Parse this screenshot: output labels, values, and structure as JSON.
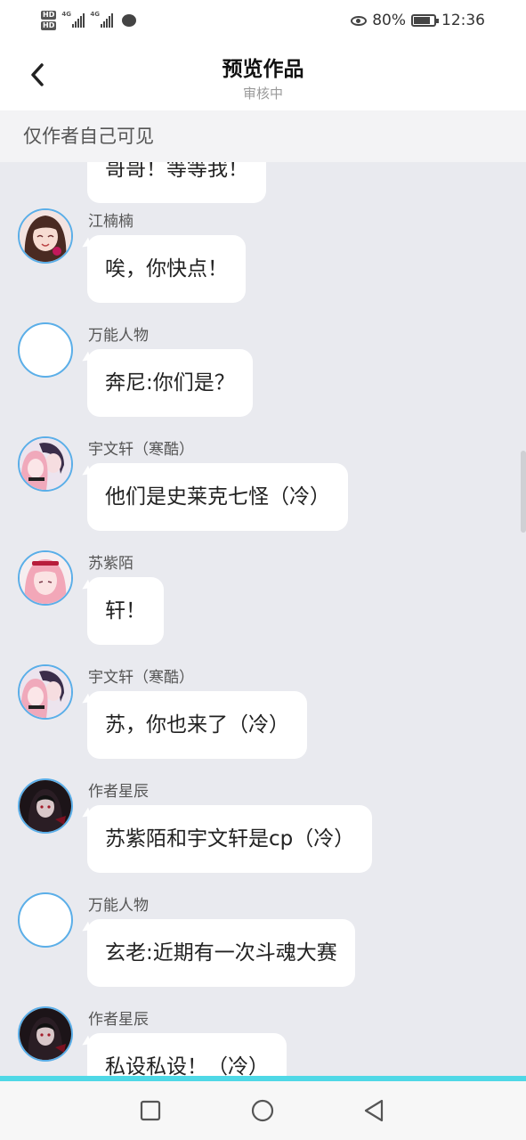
{
  "status_bar": {
    "hd1": "HD",
    "hd2": "HD",
    "net1": "4G",
    "net2": "4G",
    "battery": "80%",
    "time": "12:36",
    "icons": [
      "signal-icon",
      "message-icon",
      "eye-icon",
      "battery-icon"
    ]
  },
  "header": {
    "title": "预览作品",
    "subtitle": "审核中"
  },
  "notice": "仅作者自己可见",
  "messages": [
    {
      "name": "",
      "text": "哥哥！等等我！",
      "avatar": "none"
    },
    {
      "name": "江楠楠",
      "text": "唉，你快点！",
      "avatar": "anime-girl-brown"
    },
    {
      "name": "万能人物",
      "text": "奔尼:你们是？",
      "avatar": "blank"
    },
    {
      "name": "宇文轩（寒酷）",
      "text": "他们是史莱克七怪（冷）",
      "avatar": "anime-couple"
    },
    {
      "name": "苏紫陌",
      "text": "轩！",
      "avatar": "anime-girl-pink"
    },
    {
      "name": "宇文轩（寒酷）",
      "text": "苏，你也来了（冷）",
      "avatar": "anime-couple"
    },
    {
      "name": "作者星辰",
      "text": "苏紫陌和宇文轩是cp（冷）",
      "avatar": "anime-dark"
    },
    {
      "name": "万能人物",
      "text": "玄老:近期有一次斗魂大赛",
      "avatar": "blank"
    },
    {
      "name": "作者星辰",
      "text": "私设私设！（冷）",
      "avatar": "anime-dark"
    }
  ],
  "colors": {
    "accent_line": "#4fd8e6",
    "avatar_border": "#5aaee8",
    "chat_bg": "#e9eaef"
  },
  "nav": [
    "square-icon",
    "circle-icon",
    "triangle-back-icon"
  ]
}
